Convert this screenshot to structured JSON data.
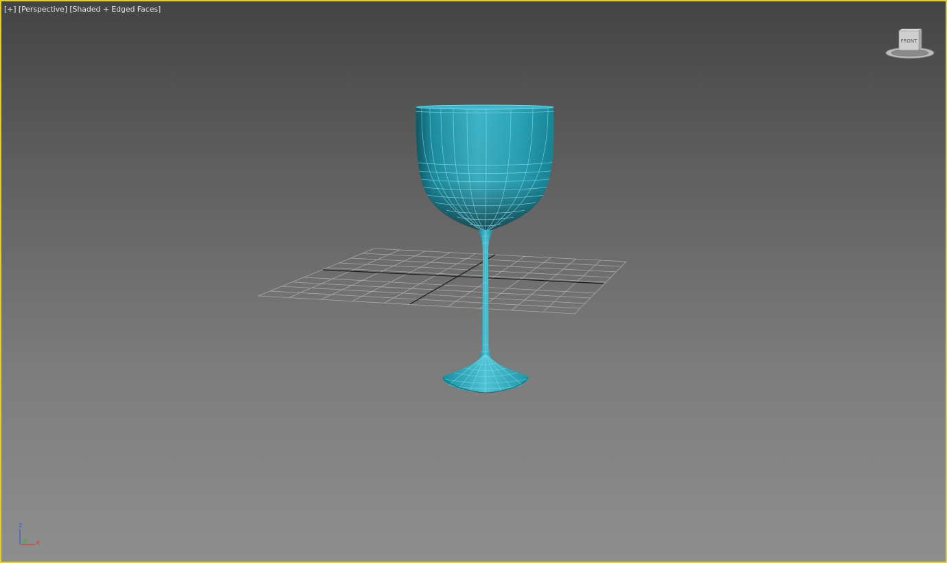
{
  "viewport": {
    "labels": {
      "plus": "[+]",
      "view": "[Perspective]",
      "shading": "[Shaded + Edged Faces]"
    },
    "border_color": "#e8d400",
    "background_top": "#444444",
    "background_bottom": "#8e8e8e"
  },
  "viewcube": {
    "face_label": "FRONT"
  },
  "scene": {
    "object_color": "#2aa6bd",
    "wire_color": "#8ee6f2",
    "grid_color": "#b4b4b4"
  },
  "axis_tripod": {
    "z": "z",
    "y": "y",
    "x": "x",
    "z_color": "#3a5bd8",
    "y_color": "#3fb23f",
    "x_color": "#d83a3a"
  }
}
